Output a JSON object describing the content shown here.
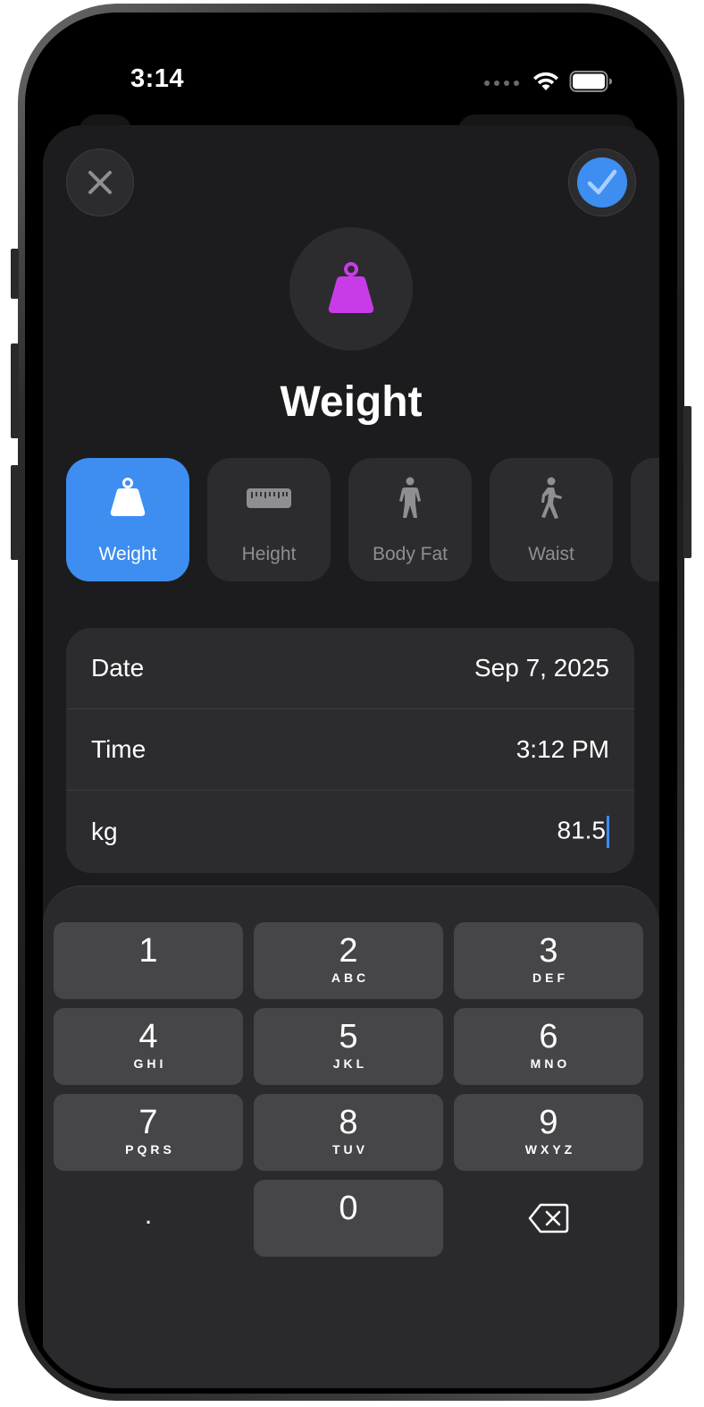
{
  "status": {
    "time": "3:14"
  },
  "sheet": {
    "close_icon": "xmark-icon",
    "done_icon": "checkmark-icon",
    "hero_icon": "scale-weight-icon",
    "title": "Weight"
  },
  "types": [
    {
      "label": "Weight",
      "icon": "scale-weight-icon",
      "active": true
    },
    {
      "label": "Height",
      "icon": "ruler-icon",
      "active": false
    },
    {
      "label": "Body Fat",
      "icon": "figure-stand-icon",
      "active": false
    },
    {
      "label": "Waist",
      "icon": "figure-walk-icon",
      "active": false
    }
  ],
  "form": {
    "date_label": "Date",
    "date_value": "Sep 7, 2025",
    "time_label": "Time",
    "time_value": "3:12 PM",
    "unit_label": "kg",
    "unit_value": "81.5"
  },
  "keypad": {
    "keys": [
      {
        "num": "1",
        "letters": ""
      },
      {
        "num": "2",
        "letters": "ABC"
      },
      {
        "num": "3",
        "letters": "DEF"
      },
      {
        "num": "4",
        "letters": "GHI"
      },
      {
        "num": "5",
        "letters": "JKL"
      },
      {
        "num": "6",
        "letters": "MNO"
      },
      {
        "num": "7",
        "letters": "PQRS"
      },
      {
        "num": "8",
        "letters": "TUV"
      },
      {
        "num": "9",
        "letters": "WXYZ"
      },
      {
        "num": ".",
        "letters": ""
      },
      {
        "num": "0",
        "letters": ""
      }
    ],
    "delete_icon": "delete-left-icon"
  },
  "colors": {
    "accent": "#3d8ef0",
    "weight_icon": "#c83ce8",
    "sheet": "#1c1c1e",
    "card": "#2c2c2e"
  }
}
